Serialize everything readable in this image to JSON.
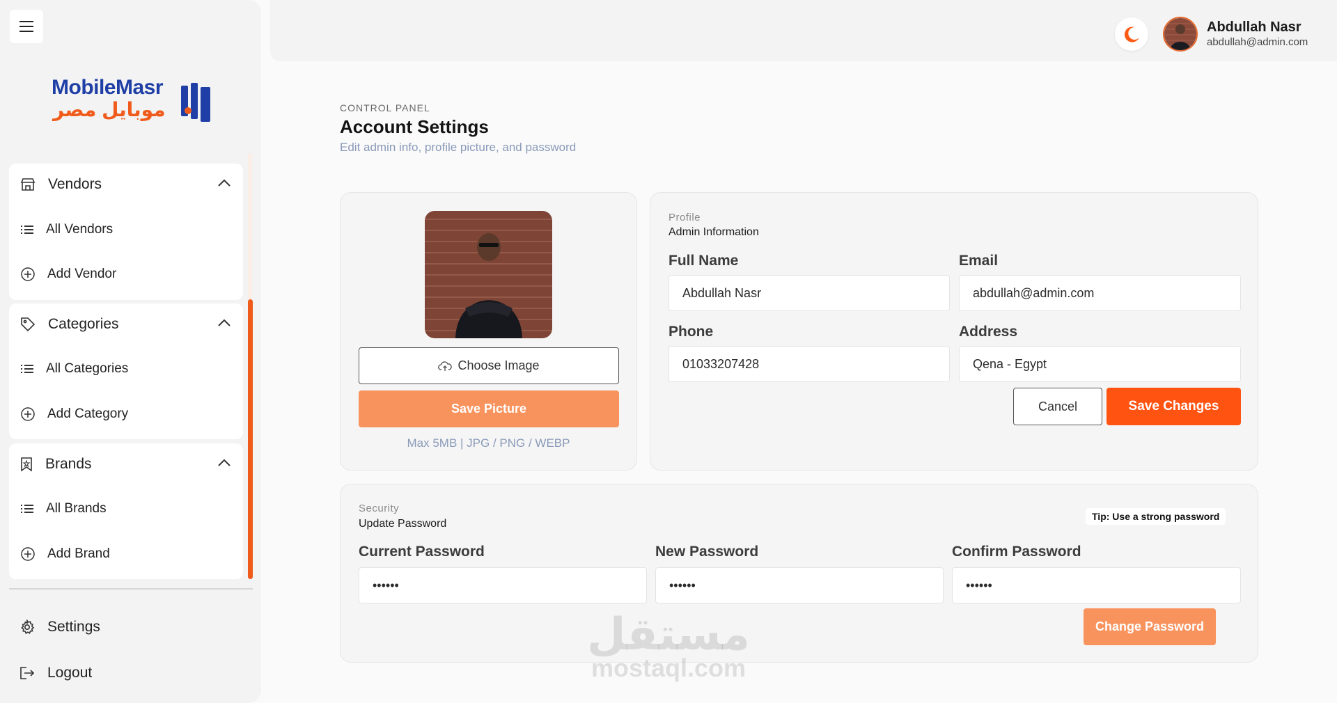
{
  "brand": {
    "name_en": "MobileMasr",
    "name_ar": "موبايل مصر"
  },
  "sidebar": {
    "groups": [
      {
        "label": "Vendors",
        "items": [
          {
            "label": "All Vendors"
          },
          {
            "label": "Add Vendor"
          }
        ]
      },
      {
        "label": "Categories",
        "items": [
          {
            "label": "All Categories"
          },
          {
            "label": "Add Category"
          }
        ]
      },
      {
        "label": "Brands",
        "items": [
          {
            "label": "All Brands"
          },
          {
            "label": "Add Brand"
          }
        ]
      }
    ],
    "settings_label": "Settings",
    "logout_label": "Logout"
  },
  "header": {
    "user_name": "Abdullah Nasr",
    "user_email": "abdullah@admin.com"
  },
  "page": {
    "eyebrow": "CONTROL PANEL",
    "title": "Account Settings",
    "subtitle": "Edit admin info, profile picture, and password"
  },
  "photo_card": {
    "choose_label": "Choose Image",
    "save_label": "Save Picture",
    "hint": "Max 5MB | JPG / PNG / WEBP"
  },
  "profile": {
    "kicker": "Profile",
    "title": "Admin Information",
    "full_name_label": "Full Name",
    "full_name": "Abdullah Nasr",
    "email_label": "Email",
    "email": "abdullah@admin.com",
    "phone_label": "Phone",
    "phone": "01033207428",
    "address_label": "Address",
    "address": "Qena - Egypt",
    "cancel_label": "Cancel",
    "save_label": "Save Changes"
  },
  "security": {
    "kicker": "Security",
    "title": "Update Password",
    "tip": "Tip: Use a strong password",
    "current_label": "Current Password",
    "current_value": "••••••",
    "new_label": "New Password",
    "new_value": "••••••",
    "confirm_label": "Confirm Password",
    "confirm_value": "••••••",
    "change_label": "Change Password"
  },
  "watermark": {
    "ar": "مستقل",
    "en": "mostaql.com"
  },
  "colors": {
    "accent": "#ff5312",
    "accent_light": "#f8935e",
    "brand_blue": "#1f3fa6",
    "muted_text": "#8a9ab8"
  },
  "icons": {
    "menu": "hamburger-icon",
    "vendors": "store-icon",
    "categories": "tag-icon",
    "brands": "bookmark-icon",
    "list": "list-icon",
    "add": "plus-circle-icon",
    "chevron": "chevron-up-icon",
    "settings": "gear-icon",
    "logout": "logout-icon",
    "theme": "moon-icon",
    "upload": "cloud-upload-icon"
  }
}
